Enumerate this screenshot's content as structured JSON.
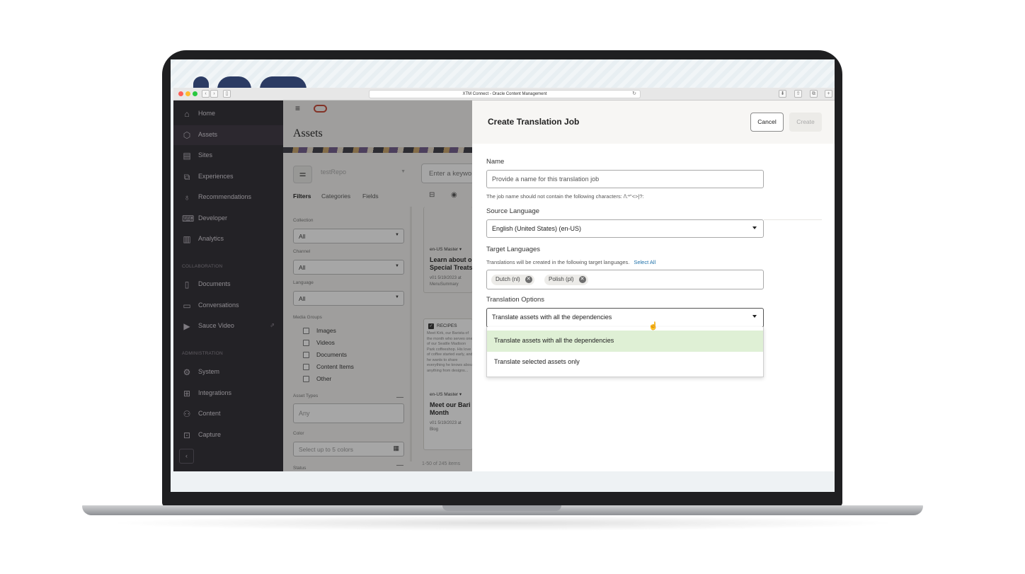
{
  "browser": {
    "url_title": "XTM Connect - Oracle Content Management",
    "traffic_colors": [
      "#fe5f57",
      "#febc2e",
      "#28c840"
    ]
  },
  "sidebar": {
    "items": [
      {
        "label": "Home",
        "icon": "home-icon",
        "glyph": "⌂"
      },
      {
        "label": "Assets",
        "icon": "cube-icon",
        "glyph": "⬡"
      },
      {
        "label": "Sites",
        "icon": "sites-icon",
        "glyph": "▤"
      },
      {
        "label": "Experiences",
        "icon": "experiences-icon",
        "glyph": "⧉"
      },
      {
        "label": "Recommendations",
        "icon": "lightbulb-icon",
        "glyph": "♁"
      },
      {
        "label": "Developer",
        "icon": "code-icon",
        "glyph": "⌨"
      },
      {
        "label": "Analytics",
        "icon": "chart-icon",
        "glyph": "▥"
      }
    ],
    "collaboration_label": "COLLABORATION",
    "collab_items": [
      {
        "label": "Documents",
        "icon": "documents-icon",
        "glyph": "▯"
      },
      {
        "label": "Conversations",
        "icon": "conversations-icon",
        "glyph": "▭"
      },
      {
        "label": "Sauce Video",
        "icon": "video-icon",
        "glyph": "▶"
      }
    ],
    "administration_label": "ADMINISTRATION",
    "admin_items": [
      {
        "label": "System",
        "icon": "gear-icon",
        "glyph": "⚙"
      },
      {
        "label": "Integrations",
        "icon": "integrations-icon",
        "glyph": "⊞"
      },
      {
        "label": "Content",
        "icon": "content-icon",
        "glyph": "⚇"
      },
      {
        "label": "Capture",
        "icon": "capture-icon",
        "glyph": "⊡"
      }
    ],
    "collapse_glyph": "‹"
  },
  "main": {
    "title": "Assets",
    "repo": "testRepo",
    "keyword_placeholder": "Enter a keyword",
    "tabs": [
      "Filters",
      "Categories",
      "Fields"
    ],
    "collection_label": "Collection",
    "collection_value": "All",
    "channel_label": "Channel",
    "channel_value": "All",
    "language_label": "Language",
    "language_value": "All",
    "media_groups_label": "Media Groups",
    "media_groups": [
      "Images",
      "Videos",
      "Documents",
      "Content Items",
      "Other"
    ],
    "asset_types_label": "Asset Types",
    "asset_types_placeholder": "Any",
    "color_label": "Color",
    "color_placeholder": "Select up to 5 colors",
    "status_label": "Status",
    "results": "1-50 of 245 items",
    "cards": [
      {
        "badge": "en-US Master ▾",
        "title1": "Learn about o",
        "title2": "Special Treats",
        "meta1": "v01  5/19/2023 at",
        "meta2": "MenuSummary"
      },
      {
        "badge": "RECIPES",
        "body": "Meet Kirk, our Barista of the month who serves one of our Seattle Madison Park coffeeshop. His love of coffee started early, and he wants to share everything he knows about anything from designs...",
        "badge2": "en-US Master ▾",
        "title1": "Meet our Bari",
        "title2": "Month",
        "meta1": "v01  5/19/2023 at",
        "meta2": "Blog"
      }
    ]
  },
  "panel": {
    "title": "Create Translation Job",
    "cancel_label": "Cancel",
    "create_label": "Create",
    "name_label": "Name",
    "name_placeholder": "Provide a name for this translation job",
    "name_helper": "The job name should not contain the following characters: /\\:*\"<>|?:",
    "source_label": "Source Language",
    "source_value": "English (United States) (en-US)",
    "target_label": "Target Languages",
    "target_helper": "Translations will be created in the following target languages.",
    "select_all": "Select All",
    "target_chips": [
      "Dutch (nl)",
      "Polish (pl)"
    ],
    "options_label": "Translation Options",
    "options_value": "Translate assets with all the dependencies",
    "options_list": [
      "Translate assets with all the dependencies",
      "Translate selected assets only"
    ]
  }
}
